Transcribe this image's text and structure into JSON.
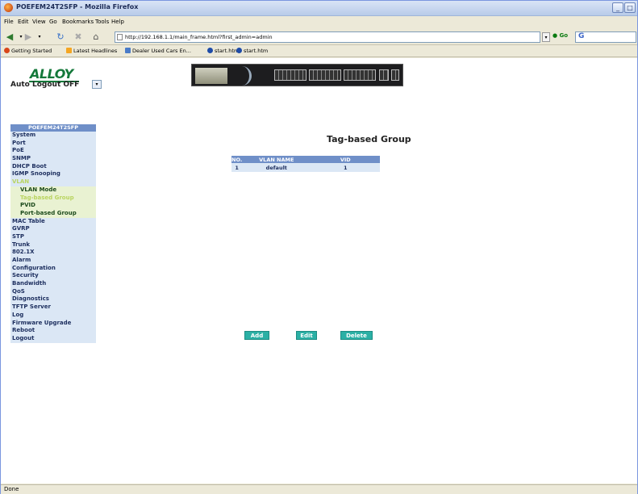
{
  "window": {
    "title": "POEFEM24T2SFP - Mozilla Firefox"
  },
  "menu": [
    "File",
    "Edit",
    "View",
    "Go",
    "Bookmarks",
    "Tools",
    "Help"
  ],
  "nav": {
    "url": "http://192.168.1.1/main_frame.html?first_admin=admin",
    "go_label": "Go"
  },
  "bookmarks": [
    "Getting Started",
    "Latest Headlines",
    "Dealer Used Cars En...",
    "start.htm",
    "start.htm"
  ],
  "header": {
    "logo": "ALLOY",
    "autologout_label": "Auto Logout OFF"
  },
  "sidebar": {
    "title": "POEFEM24T2SFP",
    "items_top": [
      "System",
      "Port",
      "PoE",
      "SNMP",
      "DHCP Boot",
      "IGMP Snooping"
    ],
    "vlan_label": "VLAN",
    "vlan_sub": [
      "VLAN Mode",
      "Tag-based Group",
      "PVID",
      "Port-based Group"
    ],
    "items_bottom": [
      "MAC Table",
      "GVRP",
      "STP",
      "Trunk",
      "802.1X",
      "Alarm",
      "Configuration",
      "Security",
      "Bandwidth",
      "QoS",
      "Diagnostics",
      "TFTP Server",
      "Log",
      "Firmware Upgrade",
      "Reboot",
      "Logout"
    ]
  },
  "main": {
    "title": "Tag-based Group",
    "table": {
      "headers": [
        "NO.",
        "VLAN NAME",
        "VID"
      ],
      "rows": [
        [
          "1",
          "default",
          "1"
        ]
      ]
    },
    "buttons": {
      "add": "Add",
      "edit": "Edit",
      "delete": "Delete"
    }
  },
  "status": {
    "text": "Done"
  },
  "colors": {
    "sidebar_header": "#6f8fc8",
    "sidebar_item_bg": "#dbe7f5",
    "active_text": "#b9d460",
    "button": "#2bb0a5"
  }
}
